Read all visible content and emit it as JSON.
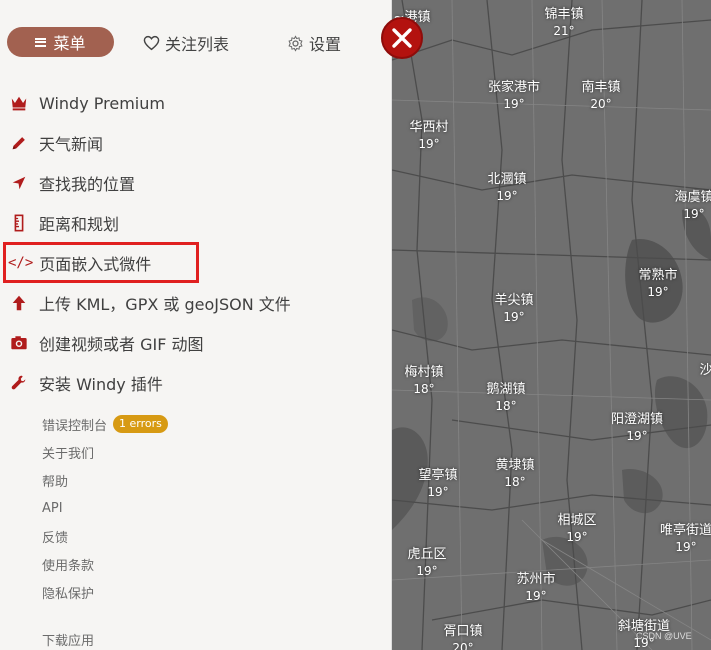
{
  "topbar": {
    "menu_label": "菜单",
    "watchlist_label": "关注列表",
    "settings_label": "设置"
  },
  "menu_items": [
    {
      "label": "Windy Premium",
      "icon": "crown-icon"
    },
    {
      "label": "天气新闻",
      "icon": "pencil-icon"
    },
    {
      "label": "查找我的位置",
      "icon": "location-arrow-icon"
    },
    {
      "label": "距离和规划",
      "icon": "ruler-icon"
    },
    {
      "label": "页面嵌入式微件",
      "icon": "code-icon",
      "highlighted": true
    },
    {
      "label": "上传 KML，GPX 或 geoJSON 文件",
      "icon": "upload-arrow-icon"
    },
    {
      "label": "创建视频或者 GIF 动图",
      "icon": "camera-icon"
    },
    {
      "label": "安装 Windy 插件",
      "icon": "plugin-wrench-icon"
    }
  ],
  "small_links": [
    {
      "label": "错误控制台",
      "badge": "1 errors"
    },
    {
      "label": "关于我们"
    },
    {
      "label": "帮助"
    },
    {
      "label": "API"
    },
    {
      "label": "反馈"
    },
    {
      "label": "使用条款"
    },
    {
      "label": "隐私保护"
    }
  ],
  "download_label": "下载应用",
  "map": {
    "cities": [
      {
        "name": "~港镇",
        "temp": ""
      },
      {
        "name": "锦丰镇",
        "temp": "21°"
      },
      {
        "name": "张家港市",
        "temp": "19°"
      },
      {
        "name": "南丰镇",
        "temp": "20°"
      },
      {
        "name": "华西村",
        "temp": "19°"
      },
      {
        "name": "北漍镇",
        "temp": "19°"
      },
      {
        "name": "海虞镇",
        "temp": "19°"
      },
      {
        "name": "常熟市",
        "temp": "19°"
      },
      {
        "name": "羊尖镇",
        "temp": "19°"
      },
      {
        "name": "梅村镇",
        "temp": "18°"
      },
      {
        "name": "鹅湖镇",
        "temp": "18°"
      },
      {
        "name": "沙",
        "temp": ""
      },
      {
        "name": "阳澄湖镇",
        "temp": "19°"
      },
      {
        "name": "望亭镇",
        "temp": "19°"
      },
      {
        "name": "黄埭镇",
        "temp": "18°"
      },
      {
        "name": "相城区",
        "temp": "19°"
      },
      {
        "name": "唯亭街道",
        "temp": "19°"
      },
      {
        "name": "虎丘区",
        "temp": "19°"
      },
      {
        "name": "苏州市",
        "temp": "19°"
      },
      {
        "name": "胥口镇",
        "temp": "20°"
      },
      {
        "name": "斜塘街道",
        "temp": "19°"
      }
    ],
    "watermark": "CSDN @UVE"
  },
  "colors": {
    "menu_button": "#a26150",
    "icon_red": "#b01c1c",
    "highlight_border": "#e02020",
    "badge": "#d79a13",
    "close_button": "#b3120f",
    "map_background": "#707070"
  }
}
